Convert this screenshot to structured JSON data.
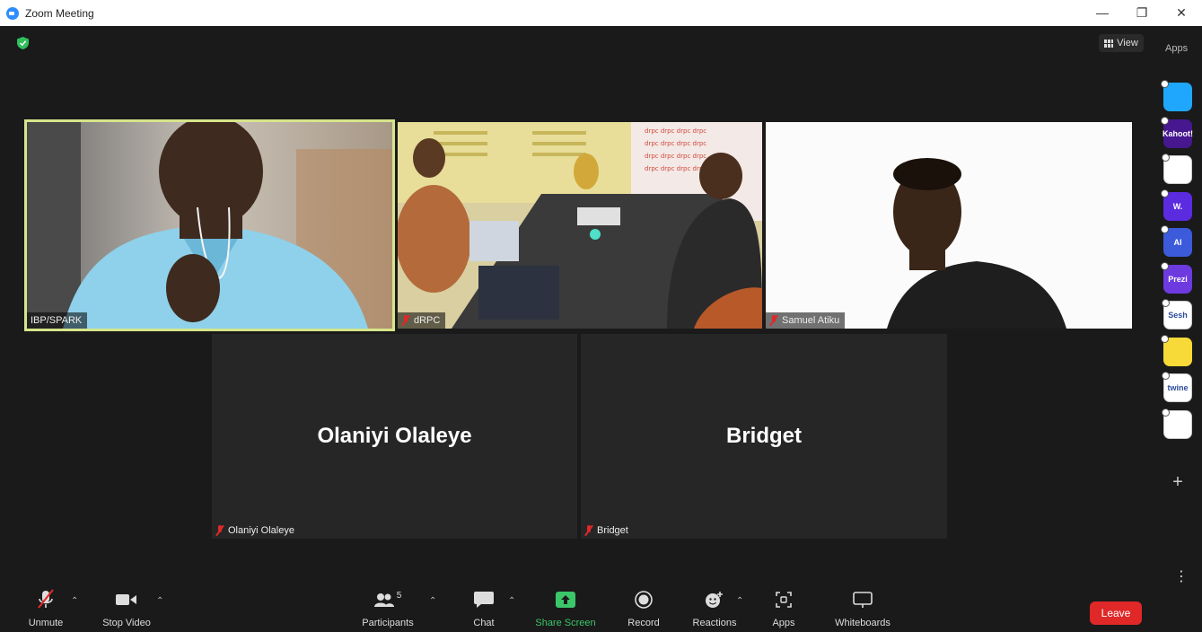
{
  "window": {
    "title": "Zoom Meeting"
  },
  "top_bar": {
    "view_label": "View",
    "apps_label": "Apps"
  },
  "apps_sidebar": [
    {
      "name": "app-tile-1",
      "text": "",
      "color": "#1ea7fd"
    },
    {
      "name": "app-tile-kahoot",
      "text": "Kahoot!",
      "color": "#46178f"
    },
    {
      "name": "app-tile-3",
      "text": "",
      "color": "#ffffff"
    },
    {
      "name": "app-tile-wooclap",
      "text": "W.",
      "color": "#5b2be0"
    },
    {
      "name": "app-tile-ai",
      "text": "AI",
      "color": "#3b5bdb"
    },
    {
      "name": "app-tile-prezi",
      "text": "Prezi",
      "color": "#6d3ae0"
    },
    {
      "name": "app-tile-sesh",
      "text": "Sesh",
      "color": "#ffffff"
    },
    {
      "name": "app-tile-smile",
      "text": "",
      "color": "#f7d938"
    },
    {
      "name": "app-tile-twine",
      "text": "twine",
      "color": "#ffffff"
    },
    {
      "name": "app-tile-blocks",
      "text": "",
      "color": "#ffffff"
    }
  ],
  "participants_grid": [
    {
      "name": "IBP/SPARK",
      "video": true,
      "active_speaker": true,
      "muted": false
    },
    {
      "name": "dRPC",
      "video": true,
      "active_speaker": false,
      "muted": true
    },
    {
      "name": "Samuel Atiku",
      "video": true,
      "active_speaker": false,
      "muted": true
    },
    {
      "name": "Olaniyi Olaleye",
      "video": false,
      "active_speaker": false,
      "muted": true
    },
    {
      "name": "Bridget",
      "video": false,
      "active_speaker": false,
      "muted": true
    }
  ],
  "toolbar": {
    "unmute": "Unmute",
    "stop_video": "Stop Video",
    "participants": "Participants",
    "participants_count": "5",
    "chat": "Chat",
    "share_screen": "Share Screen",
    "record": "Record",
    "reactions": "Reactions",
    "apps": "Apps",
    "whiteboards": "Whiteboards",
    "leave": "Leave"
  },
  "colors": {
    "share_green": "#3cc66a",
    "leave_red": "#e02828",
    "active_border": "#d6e58a",
    "zoom_blue": "#2d8cff"
  }
}
